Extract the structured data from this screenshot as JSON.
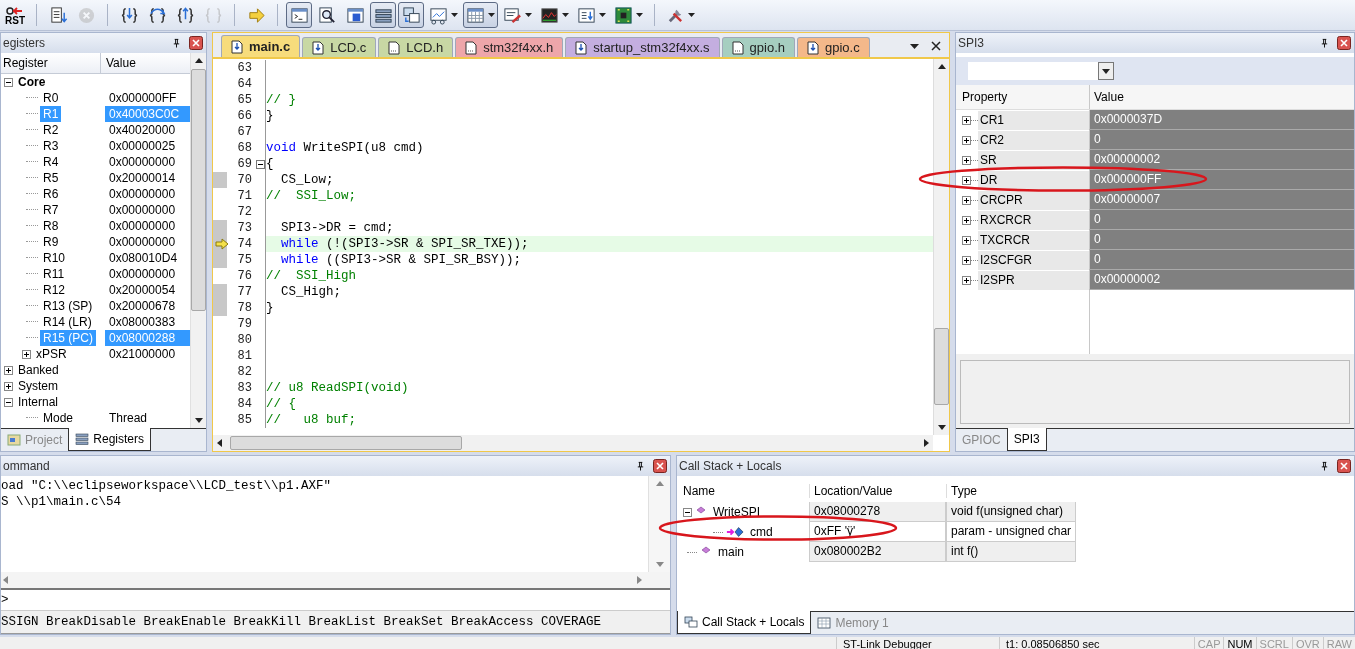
{
  "toolbar": [
    [
      {
        "kind": "reset",
        "label": "RST",
        "pressed": false,
        "disabled": false,
        "menu": false
      }
    ],
    [
      {
        "kind": "run",
        "pressed": false,
        "disabled": false,
        "menu": false
      },
      {
        "kind": "stop",
        "pressed": false,
        "disabled": true,
        "menu": false
      }
    ],
    [
      {
        "kind": "step-into",
        "pressed": false,
        "disabled": false,
        "menu": false
      },
      {
        "kind": "step-over",
        "pressed": false,
        "disabled": false,
        "menu": false
      },
      {
        "kind": "step-out",
        "pressed": false,
        "disabled": false,
        "menu": false
      },
      {
        "kind": "run-to-cursor",
        "pressed": false,
        "disabled": true,
        "menu": false
      }
    ],
    [
      {
        "kind": "show-next",
        "pressed": false,
        "disabled": false,
        "menu": false
      }
    ],
    [
      {
        "kind": "command",
        "pressed": true,
        "disabled": false,
        "menu": false
      },
      {
        "kind": "disassembly",
        "pressed": false,
        "disabled": false,
        "menu": false
      },
      {
        "kind": "symbols",
        "pressed": false,
        "disabled": false,
        "menu": false
      },
      {
        "kind": "registers",
        "pressed": true,
        "disabled": false,
        "menu": false
      },
      {
        "kind": "callstack",
        "pressed": true,
        "disabled": false,
        "menu": false
      },
      {
        "kind": "watch",
        "pressed": false,
        "disabled": false,
        "menu": true
      },
      {
        "kind": "memory",
        "pressed": true,
        "disabled": false,
        "menu": true
      },
      {
        "kind": "serial",
        "pressed": false,
        "disabled": false,
        "menu": true
      },
      {
        "kind": "analysis",
        "pressed": false,
        "disabled": false,
        "menu": true
      },
      {
        "kind": "trace",
        "pressed": false,
        "disabled": false,
        "menu": true
      },
      {
        "kind": "viewer",
        "pressed": false,
        "disabled": false,
        "menu": true
      }
    ],
    [
      {
        "kind": "toolbox",
        "pressed": false,
        "disabled": false,
        "menu": true
      }
    ]
  ],
  "registers": {
    "title": "egisters",
    "columns": [
      "Register",
      "Value"
    ],
    "items": [
      {
        "name": "Core",
        "bold": true,
        "expanded": true,
        "selected": false,
        "children": [
          {
            "name": "R0",
            "value": "0x000000FF",
            "selected": false
          },
          {
            "name": "R1",
            "value": "0x40003C0C",
            "selected": true
          },
          {
            "name": "R2",
            "value": "0x40020000",
            "selected": false
          },
          {
            "name": "R3",
            "value": "0x00000025",
            "selected": false
          },
          {
            "name": "R4",
            "value": "0x00000000",
            "selected": false
          },
          {
            "name": "R5",
            "value": "0x20000014",
            "selected": false
          },
          {
            "name": "R6",
            "value": "0x00000000",
            "selected": false
          },
          {
            "name": "R7",
            "value": "0x00000000",
            "selected": false
          },
          {
            "name": "R8",
            "value": "0x00000000",
            "selected": false
          },
          {
            "name": "R9",
            "value": "0x00000000",
            "selected": false
          },
          {
            "name": "R10",
            "value": "0x080010D4",
            "selected": false
          },
          {
            "name": "R11",
            "value": "0x00000000",
            "selected": false
          },
          {
            "name": "R12",
            "value": "0x20000054",
            "selected": false
          },
          {
            "name": "R13 (SP)",
            "value": "0x20000678",
            "selected": false
          },
          {
            "name": "R14 (LR)",
            "value": "0x08000383",
            "selected": false
          },
          {
            "name": "R15 (PC)",
            "value": "0x08000288",
            "selected": true
          },
          {
            "name": "xPSR",
            "value": "0x21000000",
            "selected": false,
            "expanded": false
          }
        ]
      },
      {
        "name": "Banked",
        "bold": false,
        "expanded": false,
        "selected": false
      },
      {
        "name": "System",
        "bold": false,
        "expanded": false,
        "selected": false
      },
      {
        "name": "Internal",
        "bold": false,
        "expanded": true,
        "selected": false,
        "children": [
          {
            "name": "Mode",
            "value": "Thread",
            "selected": false
          }
        ]
      }
    ],
    "tabs": [
      {
        "label": "Project",
        "kind": "project",
        "selected": false
      },
      {
        "label": "Registers",
        "kind": "registers",
        "selected": true
      }
    ]
  },
  "editor": {
    "tabs": [
      {
        "label": "main.c",
        "kind": "source",
        "color": "#f7dc7c",
        "selected": true
      },
      {
        "label": "LCD.c",
        "kind": "source",
        "color": "#c8d8a4",
        "selected": false
      },
      {
        "label": "LCD.h",
        "kind": "header",
        "color": "#c8d8a4",
        "selected": false
      },
      {
        "label": "stm32f4xx.h",
        "kind": "header",
        "color": "#eea6aa",
        "selected": false
      },
      {
        "label": "startup_stm32f4xx.s",
        "kind": "source",
        "color": "#c4aee0",
        "selected": false
      },
      {
        "label": "gpio.h",
        "kind": "header",
        "color": "#a6cec0",
        "selected": false
      },
      {
        "label": "gpio.c",
        "kind": "source",
        "color": "#f4b88a",
        "selected": false
      }
    ],
    "lines": [
      {
        "number": "63",
        "executable": false,
        "current": false,
        "fold": false
      },
      {
        "number": "64",
        "executable": false,
        "current": false,
        "fold": false
      },
      {
        "number": "65",
        "segments": [
          {
            "text": "// }",
            "kind": "comment"
          }
        ],
        "executable": false,
        "current": false,
        "fold": false
      },
      {
        "number": "66",
        "segments": [
          {
            "text": "}",
            "kind": "plain"
          }
        ],
        "executable": false,
        "current": false,
        "fold": false
      },
      {
        "number": "67",
        "executable": false,
        "current": false,
        "fold": false
      },
      {
        "number": "68",
        "segments": [
          {
            "text": "void",
            "kind": "keyword"
          },
          {
            "text": " WriteSPI(u8 cmd)",
            "kind": "plain"
          }
        ],
        "executable": false,
        "current": false,
        "fold": false
      },
      {
        "number": "69",
        "segments": [
          {
            "text": "{",
            "kind": "plain"
          }
        ],
        "executable": false,
        "current": false,
        "fold": true
      },
      {
        "number": "70",
        "segments": [
          {
            "text": "  CS_Low;",
            "kind": "plain"
          }
        ],
        "executable": true,
        "current": false,
        "fold": false
      },
      {
        "number": "71",
        "segments": [
          {
            "text": "//  SSI_Low;",
            "kind": "comment"
          }
        ],
        "executable": false,
        "current": false,
        "fold": false
      },
      {
        "number": "72",
        "executable": false,
        "current": false,
        "fold": false
      },
      {
        "number": "73",
        "segments": [
          {
            "text": "  SPI3->DR = cmd;",
            "kind": "plain"
          }
        ],
        "executable": true,
        "current": false,
        "fold": false
      },
      {
        "number": "74",
        "segments": [
          {
            "text": "  while",
            "kind": "keyword"
          },
          {
            "text": " (!(SPI3->SR & SPI_SR_TXE));",
            "kind": "plain"
          }
        ],
        "executable": true,
        "current": true,
        "fold": false
      },
      {
        "number": "75",
        "segments": [
          {
            "text": "  while",
            "kind": "keyword"
          },
          {
            "text": " ((SPI3->SR & SPI_SR_BSY));",
            "kind": "plain"
          }
        ],
        "executable": true,
        "current": false,
        "fold": false
      },
      {
        "number": "76",
        "segments": [
          {
            "text": "//  SSI_High",
            "kind": "comment"
          }
        ],
        "executable": false,
        "current": false,
        "fold": false
      },
      {
        "number": "77",
        "segments": [
          {
            "text": "  CS_High;",
            "kind": "plain"
          }
        ],
        "executable": true,
        "current": false,
        "fold": false
      },
      {
        "number": "78",
        "segments": [
          {
            "text": "}",
            "kind": "plain"
          }
        ],
        "executable": true,
        "current": false,
        "fold": false
      },
      {
        "number": "79",
        "executable": false,
        "current": false,
        "fold": false
      },
      {
        "number": "80",
        "executable": false,
        "current": false,
        "fold": false
      },
      {
        "number": "81",
        "executable": false,
        "current": false,
        "fold": false
      },
      {
        "number": "82",
        "executable": false,
        "current": false,
        "fold": false
      },
      {
        "number": "83",
        "segments": [
          {
            "text": "// u8 ReadSPI(void)",
            "kind": "comment"
          }
        ],
        "executable": false,
        "current": false,
        "fold": false
      },
      {
        "number": "84",
        "segments": [
          {
            "text": "// {",
            "kind": "comment"
          }
        ],
        "executable": false,
        "current": false,
        "fold": false
      },
      {
        "number": "85",
        "segments": [
          {
            "text": "//   u8 buf;",
            "kind": "comment"
          }
        ],
        "executable": false,
        "current": false,
        "fold": false
      }
    ]
  },
  "peripheral": {
    "title": "SPI3",
    "columns": [
      "Property",
      "Value"
    ],
    "rows": [
      {
        "name": "CR1",
        "value": "0x0000037D"
      },
      {
        "name": "CR2",
        "value": "0"
      },
      {
        "name": "SR",
        "value": "0x00000002"
      },
      {
        "name": "DR",
        "value": "0x000000FF"
      },
      {
        "name": "CRCPR",
        "value": "0x00000007"
      },
      {
        "name": "RXCRCR",
        "value": "0"
      },
      {
        "name": "TXCRCR",
        "value": "0"
      },
      {
        "name": "I2SCFGR",
        "value": "0"
      },
      {
        "name": "I2SPR",
        "value": "0x00000002"
      }
    ],
    "tabs": [
      {
        "label": "GPIOC",
        "selected": false
      },
      {
        "label": "SPI3",
        "selected": true
      }
    ]
  },
  "command": {
    "title": "ommand",
    "output": [
      "oad \"C:\\\\eclipseworkspace\\\\LCD_test\\\\p1.AXF\"",
      "S \\\\p1\\main.c\\54"
    ],
    "prompt": ">",
    "hint": "SSIGN BreakDisable BreakEnable BreakKill BreakList BreakSet BreakAccess COVERAGE"
  },
  "callstack": {
    "title": "Call Stack + Locals",
    "columns": [
      "Name",
      "Location/Value",
      "Type"
    ],
    "items": [
      {
        "name": "WriteSPI",
        "kind": "function",
        "value": "0x08000278",
        "type": "void f(unsigned char)",
        "expanded": true,
        "children": [
          {
            "name": "cmd",
            "kind": "param",
            "value": "0xFF 'ÿ'",
            "type": "param - unsigned char"
          }
        ]
      },
      {
        "name": "main",
        "kind": "function",
        "value": "0x080002B2",
        "type": "int f()"
      }
    ],
    "tabs": [
      {
        "label": "Call Stack + Locals",
        "kind": "callstack",
        "selected": true
      },
      {
        "label": "Memory 1",
        "kind": "memory",
        "selected": false
      }
    ]
  },
  "status_bar": {
    "debugger": "ST-Link Debugger",
    "time": "t1: 0.08506850 sec",
    "indicators": [
      {
        "label": "CAP",
        "on": false
      },
      {
        "label": "NUM",
        "on": true
      },
      {
        "label": "SCRL",
        "on": false
      },
      {
        "label": "OVR",
        "on": false
      },
      {
        "label": "RAW",
        "on": false
      }
    ]
  }
}
